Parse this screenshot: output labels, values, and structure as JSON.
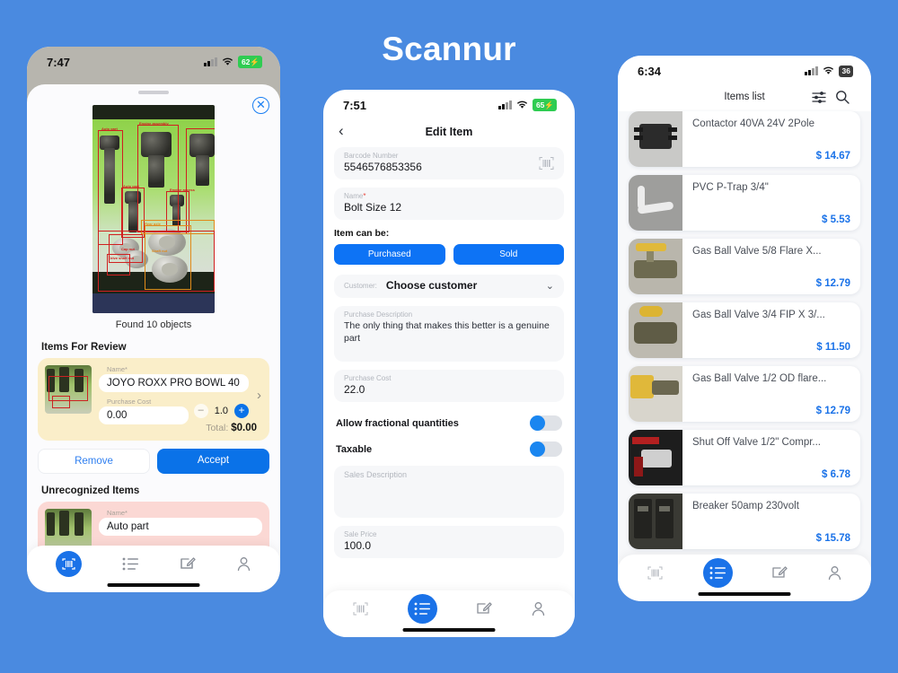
{
  "brand": "Scannur",
  "background_color": "#4a8ae0",
  "accent_color": "#0a72e8",
  "phone1": {
    "status": {
      "time": "7:47",
      "battery": "62",
      "wifi_icon": "wifi-icon",
      "signal_icon": "cellular-icon"
    },
    "close_icon": "close-circle-icon",
    "preview_caption": "Found 10 objects",
    "detection_labels": [
      "Auto part",
      "Engine assembly",
      "Auto part",
      "Engine access",
      "Auto part",
      "Engine",
      "Cap nut",
      "Drive shaft nut",
      "Rear axle",
      "Shaft nut"
    ],
    "review_title": "Items For Review",
    "review_item": {
      "name_label": "Name*",
      "name_value": "JOYO ROXX PRO BOWL 40",
      "cost_label": "Purchase Cost",
      "cost_value": "0.00",
      "qty": "1.0",
      "minus_label": "–",
      "plus_label": "+",
      "total_label": "Total:",
      "total_value": "$0.00",
      "chevron_icon": "chevron-right-icon"
    },
    "buttons": {
      "remove": "Remove",
      "accept": "Accept"
    },
    "unrecognized_title": "Unrecognized Items",
    "unrecognized_item": {
      "name_label": "Name*",
      "name_value": "Auto part"
    },
    "nav": [
      {
        "name": "barcode-scan-icon",
        "active": false
      },
      {
        "name": "items-list-icon",
        "active": true
      },
      {
        "name": "edit-note-icon",
        "active": false
      },
      {
        "name": "profile-icon",
        "active": false
      }
    ]
  },
  "phone2": {
    "status": {
      "time": "7:51",
      "battery": "65"
    },
    "back_icon": "back-chevron-icon",
    "title": "Edit Item",
    "fields": [
      {
        "label": "Barcode Number",
        "value": "5546576853356",
        "icon": "barcode-icon"
      },
      {
        "label": "Name",
        "required": "*",
        "value": "Bolt Size 12"
      }
    ],
    "item_can_be_label": "Item can be:",
    "segments": [
      "Purchased",
      "Sold"
    ],
    "customer": {
      "label": "Customer:",
      "value": "Choose customer",
      "chevron_icon": "chevron-down-icon"
    },
    "purchase_description": {
      "label": "Purchase Description",
      "value": "The only thing that makes this better is a genuine part"
    },
    "purchase_cost": {
      "label": "Purchase Cost",
      "value": "22.0"
    },
    "toggles": [
      {
        "label": "Allow fractional quantities",
        "state": "off"
      },
      {
        "label": "Taxable",
        "state": "off"
      }
    ],
    "sales_description": {
      "label": "Sales Description",
      "value": ""
    },
    "sale_price": {
      "label": "Sale Price",
      "value": "100.0"
    },
    "nav": [
      {
        "name": "barcode-scan-icon",
        "active": false
      },
      {
        "name": "items-list-icon",
        "active": true
      },
      {
        "name": "edit-note-icon",
        "active": false
      },
      {
        "name": "profile-icon",
        "active": false
      }
    ]
  },
  "phone3": {
    "status": {
      "time": "6:34",
      "battery": "36"
    },
    "title": "Items list",
    "filter_icon": "filter-sliders-icon",
    "search_icon": "search-icon",
    "items": [
      {
        "name": "Contactor 40VA 24V 2Pole",
        "price": "$ 14.67",
        "thumb": "contactor-photo"
      },
      {
        "name": "PVC P-Trap 3/4\"",
        "price": "$ 5.53",
        "thumb": "ptrap-photo"
      },
      {
        "name": "Gas Ball Valve 5/8 Flare X...",
        "price": "$ 12.79",
        "thumb": "ballvalve-photo"
      },
      {
        "name": "Gas Ball Valve 3/4 FIP X 3/...",
        "price": "$ 11.50",
        "thumb": "ballvalve2-photo"
      },
      {
        "name": "Gas Ball Valve 1/2 OD flare...",
        "price": "$ 12.79",
        "thumb": "ballvalve3-photo"
      },
      {
        "name": "Shut Off Valve 1/2\" Compr...",
        "price": "$ 6.78",
        "thumb": "shutoff-photo"
      },
      {
        "name": "Breaker 50amp 230volt",
        "price": "$ 15.78",
        "thumb": "breaker-photo"
      }
    ],
    "nav": [
      {
        "name": "barcode-scan-icon",
        "active": false
      },
      {
        "name": "items-list-icon",
        "active": true
      },
      {
        "name": "edit-note-icon",
        "active": false
      },
      {
        "name": "profile-icon",
        "active": false
      }
    ]
  }
}
